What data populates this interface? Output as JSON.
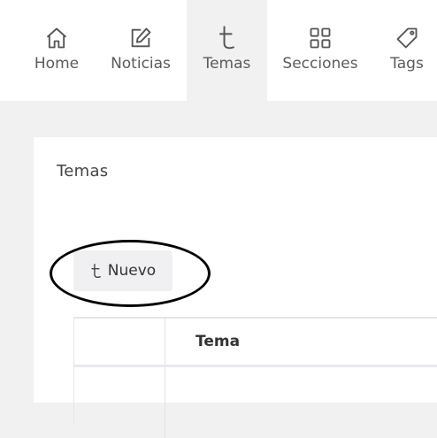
{
  "nav": {
    "items": [
      {
        "label": "Home",
        "icon": "home-icon",
        "active": false
      },
      {
        "label": "Noticias",
        "icon": "edit-icon",
        "active": false
      },
      {
        "label": "Temas",
        "icon": "tumblr-icon",
        "active": true
      },
      {
        "label": "Secciones",
        "icon": "grid-icon",
        "active": false
      },
      {
        "label": "Tags",
        "icon": "tag-icon",
        "active": false
      }
    ]
  },
  "panel": {
    "title": "Temas",
    "new_button_label": "Nuevo",
    "new_button_icon": "tumblr-icon"
  },
  "table": {
    "columns": [
      "",
      "Tema"
    ]
  },
  "colors": {
    "page_background": "#f1f1f1",
    "active_tab": "#f1f1f1",
    "annotation": "#000000"
  }
}
